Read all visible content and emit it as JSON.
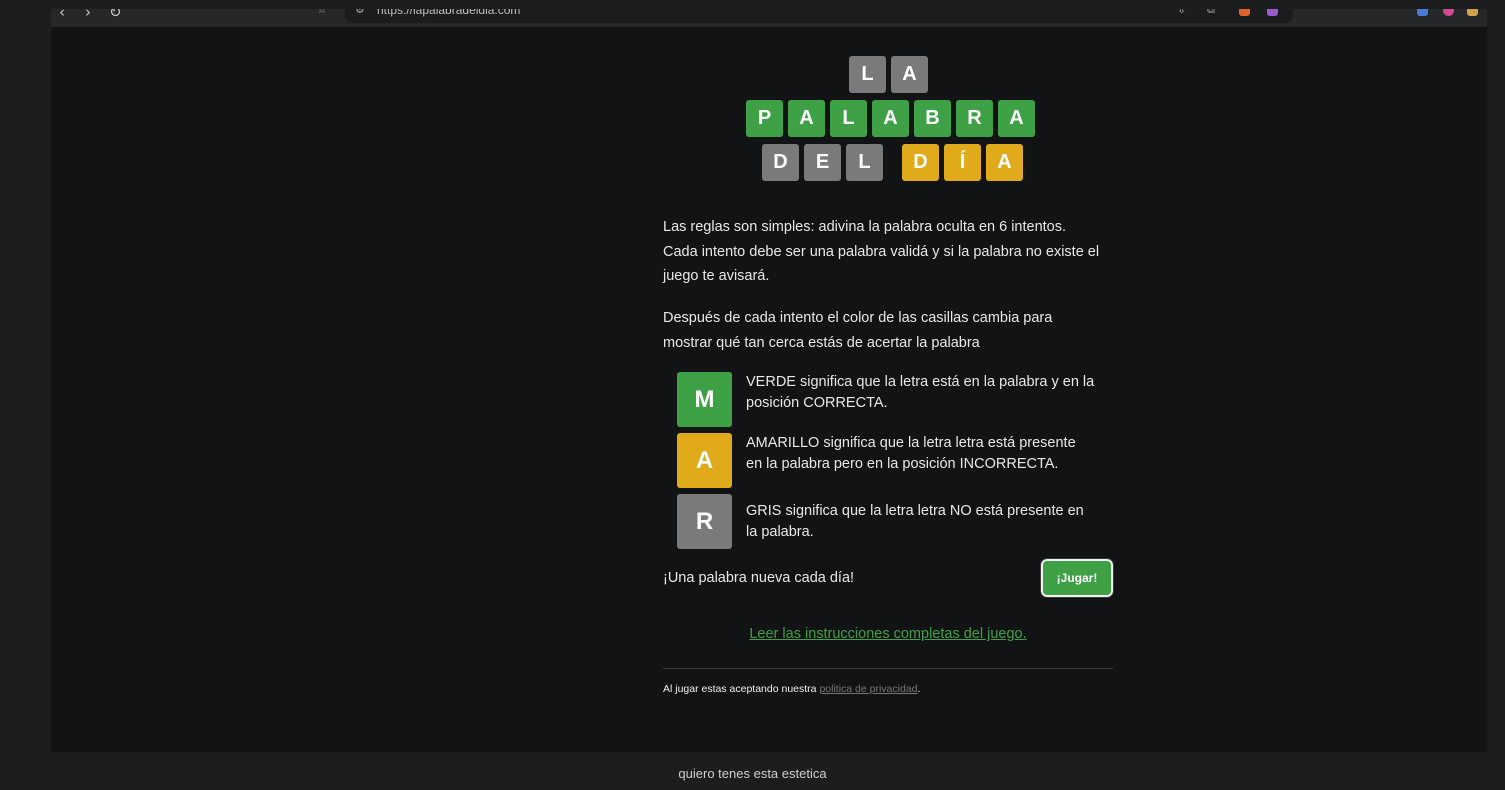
{
  "browser": {
    "url": "https://lapalabradeldia.com",
    "nav": {
      "back": "‹",
      "forward": "›",
      "reload": "↻"
    }
  },
  "logo": {
    "row1": [
      "L",
      "A"
    ],
    "row2": [
      "P",
      "A",
      "L",
      "A",
      "B",
      "R",
      "A"
    ],
    "row3a": [
      "D",
      "E",
      "L"
    ],
    "row3b": [
      "D",
      "Í",
      "A"
    ]
  },
  "rules": {
    "p1_l1": "Las reglas son simples: adivina la palabra oculta en 6 intentos.",
    "p1_l2": "Cada intento debe ser una palabra validá y si la palabra no existe el",
    "p1_l3": "juego te avisará.",
    "p2_l1": "Después de cada intento el color de las casillas cambia para",
    "p2_l2": "mostrar qué tan cerca estás de acertar la palabra"
  },
  "legend": [
    {
      "letter": "M",
      "color": "#3fa146",
      "line1": "VERDE significa que la letra está en la palabra y en la",
      "line2": "posición CORRECTA."
    },
    {
      "letter": "A",
      "color": "#e1aa1b",
      "line1": "AMARILLO significa que la letra letra está presente",
      "line2": "en la palabra pero en la posición INCORRECTA."
    },
    {
      "letter": "R",
      "color": "#7a7a7a",
      "line1": "GRIS significa que la letra letra NO está presente en",
      "line2": "la palabra."
    }
  ],
  "tagline": "¡Una palabra nueva cada día!",
  "play_button": "¡Jugar!",
  "instructions_link": "Leer las instrucciones completas del juego.",
  "footer": {
    "text": "Al jugar estas aceptando nuestra ",
    "link": "politica de privacidad",
    "end": "."
  },
  "caption": "quiero tenes esta estetica"
}
